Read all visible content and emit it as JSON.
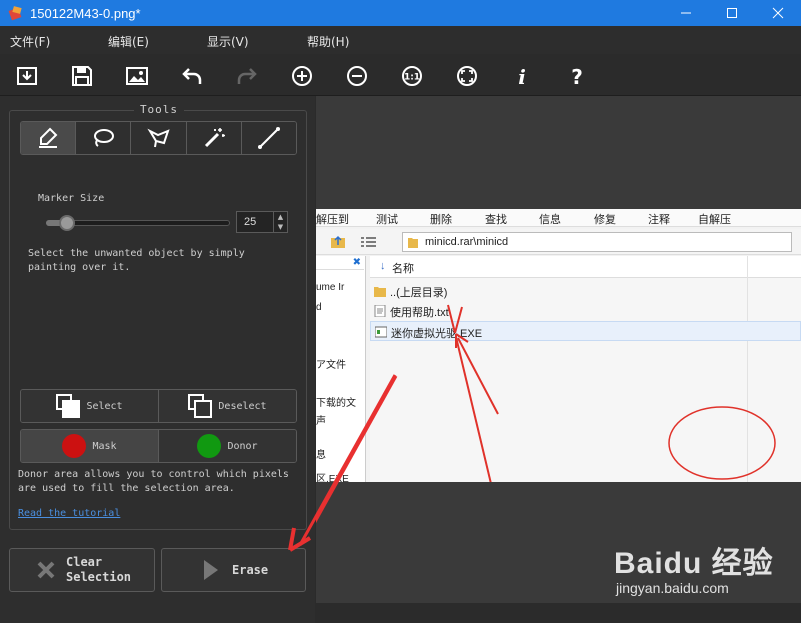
{
  "window": {
    "title": "150122M43-0.png*",
    "accent": "#1f7ae0"
  },
  "menu": [
    "文件(F)",
    "编辑(E)",
    "显示(V)",
    "帮助(H)"
  ],
  "toolbar": [
    "open-icon",
    "save-icon",
    "image-icon",
    "undo-icon",
    "redo-icon",
    "zoom-in-icon",
    "zoom-out-icon",
    "actual-size-icon",
    "fit-icon",
    "info-icon",
    "help-icon"
  ],
  "tools": {
    "legend": "Tools",
    "buttons": [
      "marker-icon",
      "lasso-icon",
      "polygon-lasso-icon",
      "magic-wand-icon",
      "line-icon"
    ],
    "marker_size_label": "Marker Size",
    "marker_size": "25",
    "marker_fraction": 0.08,
    "hint": "Select the unwanted object by simply painting over it.",
    "select_label": "Select",
    "deselect_label": "Deselect",
    "mask_label": "Mask",
    "donor_label": "Donor",
    "mask_color": "#cc1111",
    "donor_color": "#119911",
    "donor_text": "Donor area allows you to control which pixels are used to fill the selection area.",
    "tutorial": "Read the tutorial"
  },
  "actions": {
    "clear_line1": "Clear",
    "clear_line2": "Selection",
    "erase": "Erase"
  },
  "image": {
    "menubar": [
      "解压到",
      "测试",
      "删除",
      "查找",
      "信息",
      "修复",
      "注释",
      "自解压"
    ],
    "path": "minicd.rar\\minicd",
    "left_fragments": [
      "ume Ir",
      "d",
      "ア文件",
      "下载的文",
      "声",
      "息",
      "区.EXE"
    ],
    "column_header": "名称",
    "rows": [
      "..(上层目录)",
      "使用帮助.txt",
      "迷你虚拟光驱.EXE"
    ],
    "watermark_brand": "Baidu 经验",
    "watermark_url": "jingyan.baidu.com"
  }
}
